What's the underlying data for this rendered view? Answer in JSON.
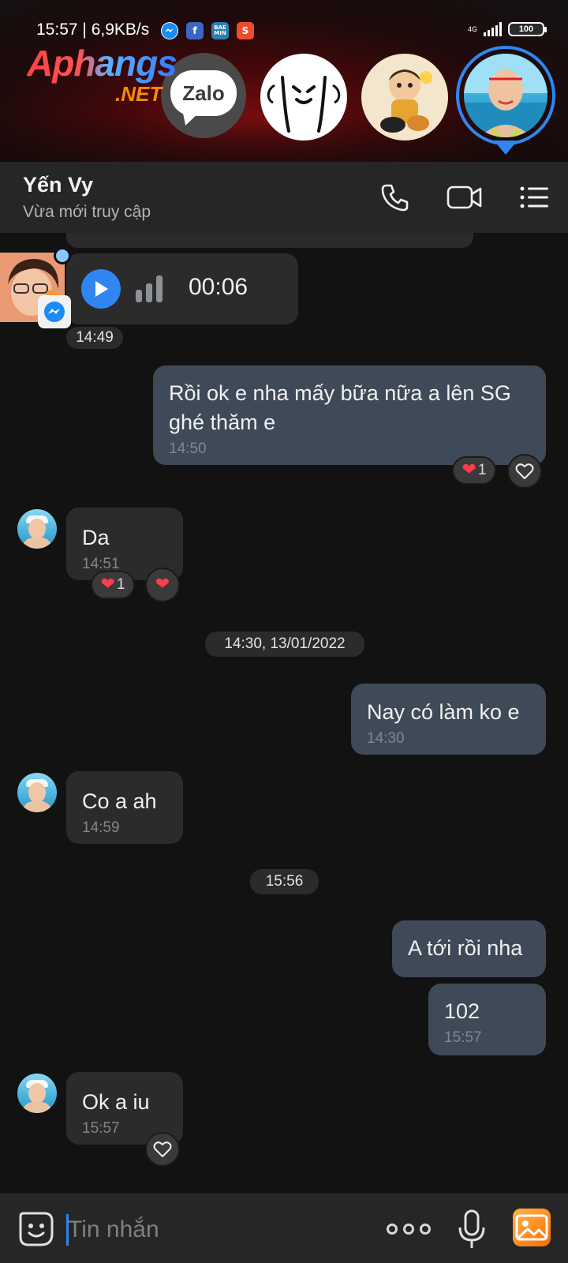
{
  "status_bar": {
    "time": "15:57",
    "speed": "6,9KB/s",
    "network": "4G",
    "battery": "100",
    "notif_icons": [
      "messenger-icon",
      "facebook-icon",
      "baemin-icon",
      "shopee-icon"
    ],
    "baemin_label": "BAE MIN",
    "shopee_label": "S",
    "facebook_label": "f"
  },
  "brand": {
    "name": "Aphangs",
    "suffix": ".NET"
  },
  "chat_heads": {
    "zalo_label": "Zalo"
  },
  "header": {
    "contact_name": "Yến Vy",
    "contact_status": "Vừa mới truy cập"
  },
  "messages": {
    "voice_duration": "00:06",
    "voice_time": "14:49",
    "m1_text": "Rồi ok e nha mấy bữa nữa a lên SG ghé thăm e",
    "m1_time": "14:50",
    "m1_reaction_count": "1",
    "m2_text": "Da",
    "m2_time": "14:51",
    "m2_reaction_count": "1",
    "date_divider": "14:30, 13/01/2022",
    "m3_text": "Nay có làm ko e",
    "m3_time": "14:30",
    "m4_text": "Co a ah",
    "m4_time": "14:59",
    "time_divider": "15:56",
    "m5_text": "A tới rồi nha",
    "m6_text": "102",
    "m6_time": "15:57",
    "m7_text": "Ok a iu",
    "m7_time": "15:57"
  },
  "input": {
    "placeholder": "Tin nhắn"
  },
  "colors": {
    "background": "#121212",
    "incoming_bubble": "#2b2b2b",
    "outgoing_bubble": "#3f4a58",
    "accent_blue": "#2f86f0",
    "heart_red": "#ff3b4e"
  }
}
